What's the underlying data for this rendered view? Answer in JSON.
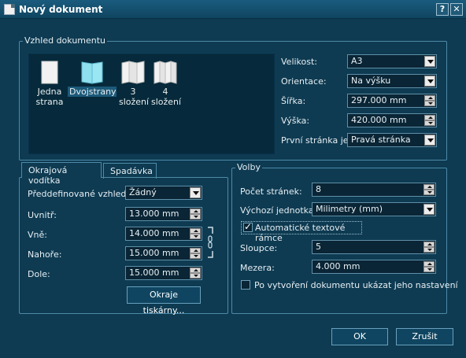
{
  "window": {
    "title": "Nový dokument",
    "help_label": "?",
    "close_label": "✕"
  },
  "layout_group": {
    "title": "Vzhled dokumentu",
    "options": [
      {
        "label": "Jedna strana",
        "icon": "single-page-icon"
      },
      {
        "label": "Dvojstrany",
        "icon": "double-page-icon",
        "selected": true
      },
      {
        "label": "3 složení",
        "icon": "three-fold-icon"
      },
      {
        "label": "4 složení",
        "icon": "four-fold-icon"
      }
    ],
    "size_label": "Velikost:",
    "size_value": "A3",
    "orientation_label": "Orientace:",
    "orientation_value": "Na výšku",
    "width_label": "Šířka:",
    "width_value": "297.000 mm",
    "height_label": "Výška:",
    "height_value": "420.000 mm",
    "first_page_label": "První stránka je:",
    "first_page_value": "Pravá stránka"
  },
  "tabs": [
    {
      "label": "Okrajová vodítka",
      "active": true
    },
    {
      "label": "Spadávka",
      "active": false
    }
  ],
  "margins": {
    "preset_label": "Předdefinované vzhledy:",
    "preset_value": "Žádný",
    "inside_label": "Uvnitř:",
    "inside_value": "13.000 mm",
    "outside_label": "Vně:",
    "outside_value": "14.000 mm",
    "top_label": "Nahoře:",
    "top_value": "15.000 mm",
    "bottom_label": "Dole:",
    "bottom_value": "15.000 mm",
    "printer_margins_label": "Okraje tiskárny..."
  },
  "options_group": {
    "title": "Volby",
    "pages_label": "Počet stránek:",
    "pages_value": "8",
    "unit_label": "Výchozí jednotka:",
    "unit_value": "Milimetry (mm)",
    "auto_frames_label": "Automatické textové rámce",
    "auto_frames_checked": true,
    "columns_label": "Sloupce:",
    "columns_value": "5",
    "gap_label": "Mezera:",
    "gap_value": "4.000 mm",
    "show_settings_label": "Po vytvoření dokumentu ukázat jeho nastavení",
    "show_settings_checked": false
  },
  "buttons": {
    "ok": "OK",
    "cancel": "Zrušit"
  }
}
